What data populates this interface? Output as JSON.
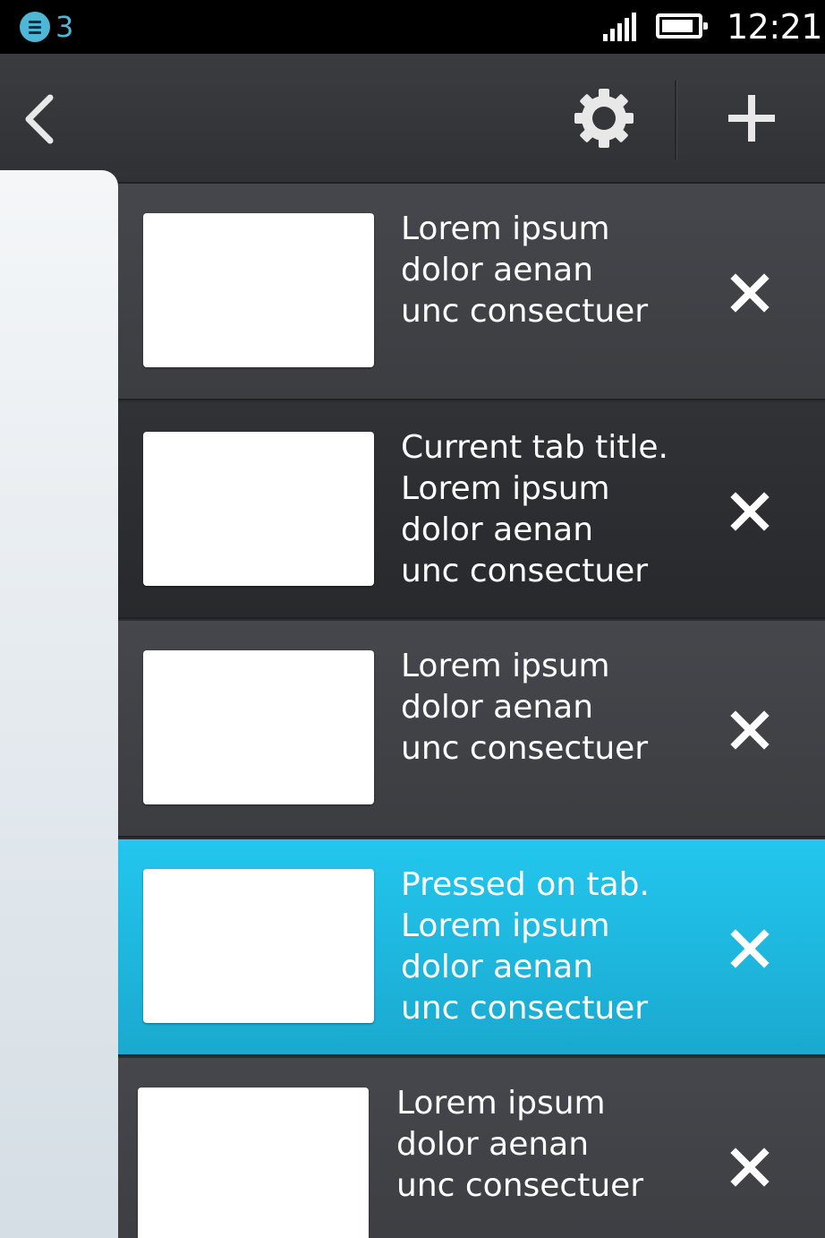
{
  "status_bar": {
    "notification_count": "3",
    "time": "12:21",
    "battery_level": 0.9,
    "signal_bars": 5
  },
  "toolbar": {
    "back_icon": "chevron-left-icon",
    "settings_icon": "gear-icon",
    "add_icon": "plus-icon"
  },
  "tabs": [
    {
      "state": "default",
      "title": "Lorem ipsum\ndolor aenan\nunc consectuer"
    },
    {
      "state": "current",
      "title": "Current tab title.\nLorem ipsum\ndolor aenan\nunc consectuer"
    },
    {
      "state": "default",
      "title": "Lorem ipsum\ndolor aenan\nunc consectuer"
    },
    {
      "state": "pressed",
      "title": "Pressed on tab.\nLorem ipsum\ndolor aenan\nunc consectuer"
    },
    {
      "state": "default",
      "title": "Lorem ipsum\ndolor aenan\nunc consectuer"
    }
  ],
  "colors": {
    "pressed_accent": "#1fb9e0",
    "notification_accent": "#4fb7d6"
  }
}
